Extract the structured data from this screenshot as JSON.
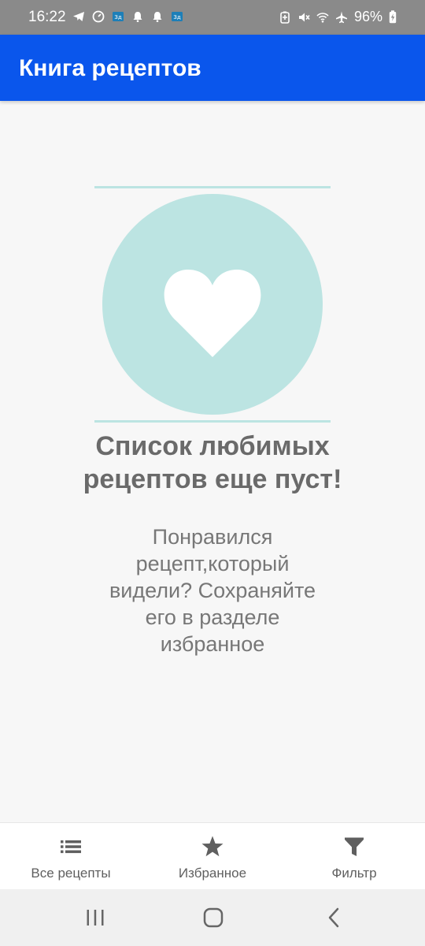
{
  "status_bar": {
    "time": "16:22",
    "battery_percent": "96%",
    "left_icons": [
      "telegram-icon",
      "speedometer-icon",
      "notification-app-icon",
      "bell-icon",
      "bell-icon",
      "notification-app-icon"
    ],
    "right_icons": [
      "battery-saver-icon",
      "mute-icon",
      "wifi-icon",
      "airplane-icon",
      "battery-charging-icon"
    ]
  },
  "app_bar": {
    "title": "Книга рецептов",
    "color": "#0a56ec"
  },
  "empty_state": {
    "illustration_icon": "heart-icon",
    "circle_color": "#bce4e2",
    "title": "Список любимых рецептов еще пуст!",
    "description": "Понравился рецепт,который видели? Сохраняйте его в разделе избранное"
  },
  "bottom_nav": {
    "items": [
      {
        "label": "Все рецепты",
        "icon": "list-icon"
      },
      {
        "label": "Избранное",
        "icon": "star-icon"
      },
      {
        "label": "Фильтр",
        "icon": "filter-icon"
      }
    ]
  },
  "system_nav": {
    "buttons": [
      "recent-apps-icon",
      "home-icon",
      "back-icon"
    ]
  }
}
